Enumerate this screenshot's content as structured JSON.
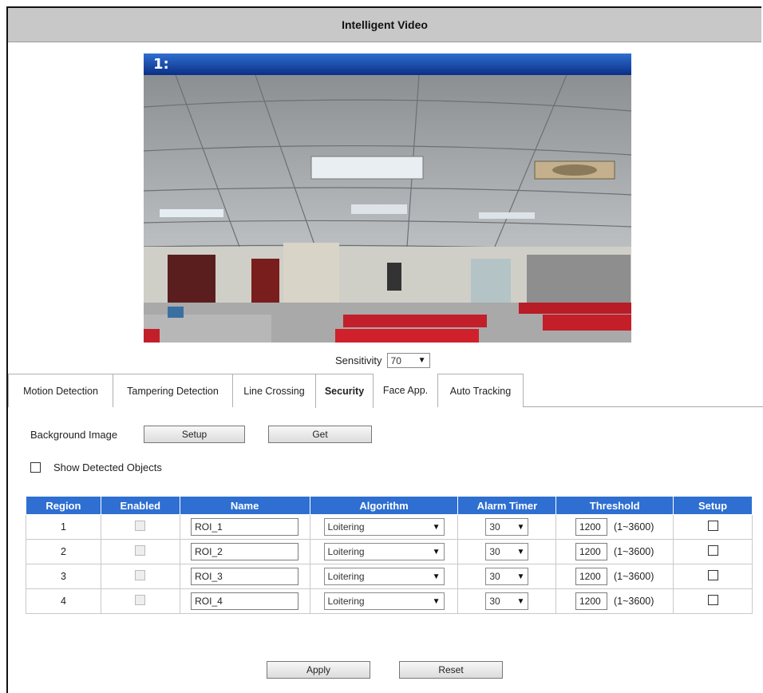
{
  "title": "Intelligent Video",
  "video": {
    "channel_label": "1:"
  },
  "sensitivity": {
    "label": "Sensitivity",
    "value": "70"
  },
  "tabs": [
    {
      "label": "Motion Detection"
    },
    {
      "label": "Tampering Detection"
    },
    {
      "label": "Line Crossing"
    },
    {
      "label": "Security",
      "active": true
    },
    {
      "label": "Face App."
    },
    {
      "label": "Auto Tracking"
    }
  ],
  "background_image": {
    "label": "Background Image",
    "setup_label": "Setup",
    "get_label": "Get"
  },
  "show_detected": {
    "label": "Show Detected Objects",
    "checked": false
  },
  "table": {
    "headers": [
      "Region",
      "Enabled",
      "Name",
      "Algorithm",
      "Alarm Timer",
      "Threshold",
      "Setup"
    ],
    "rows": [
      {
        "region": "1",
        "name": "ROI_1",
        "algorithm": "Loitering",
        "alarm_timer": "30",
        "threshold": "1200",
        "range": "(1~3600)"
      },
      {
        "region": "2",
        "name": "ROI_2",
        "algorithm": "Loitering",
        "alarm_timer": "30",
        "threshold": "1200",
        "range": "(1~3600)"
      },
      {
        "region": "3",
        "name": "ROI_3",
        "algorithm": "Loitering",
        "alarm_timer": "30",
        "threshold": "1200",
        "range": "(1~3600)"
      },
      {
        "region": "4",
        "name": "ROI_4",
        "algorithm": "Loitering",
        "alarm_timer": "30",
        "threshold": "1200",
        "range": "(1~3600)"
      }
    ]
  },
  "footer": {
    "apply_label": "Apply",
    "reset_label": "Reset"
  },
  "colors": {
    "header_blue": "#2e6fd1",
    "titlebar_gray": "#c8c8c8"
  }
}
